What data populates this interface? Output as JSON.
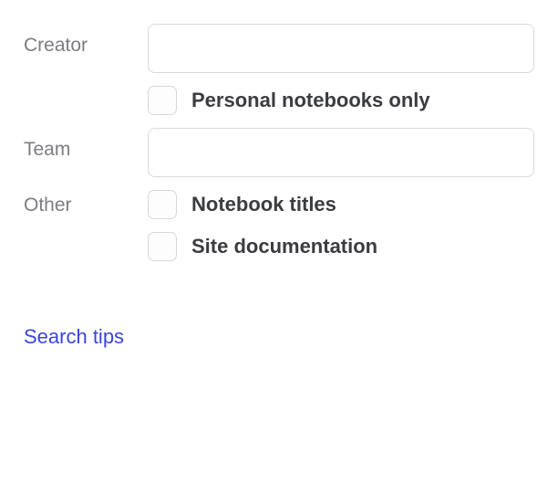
{
  "form": {
    "creator": {
      "label": "Creator",
      "value": "",
      "personal_only_label": "Personal notebooks only"
    },
    "team": {
      "label": "Team",
      "value": ""
    },
    "other": {
      "label": "Other",
      "notebook_titles_label": "Notebook titles",
      "site_documentation_label": "Site documentation"
    }
  },
  "footer": {
    "search_tips_label": "Search tips"
  }
}
